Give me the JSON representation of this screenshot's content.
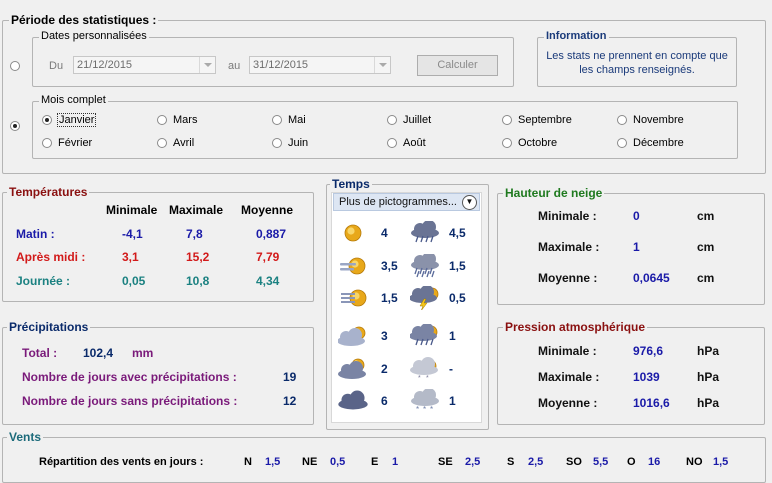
{
  "periode": {
    "title": "Période des statistiques :",
    "dates_perso": {
      "title": "Dates personnalisées",
      "du_label": "Du",
      "du_value": "21/12/2015",
      "au_label": "au",
      "au_value": "31/12/2015",
      "calc_label": "Calculer"
    },
    "info": {
      "title": "Information",
      "line1": "Les stats ne prennent en compte que",
      "line2": "les champs renseignés."
    },
    "mois": {
      "title": "Mois complet",
      "months": [
        "Janvier",
        "Février",
        "Mars",
        "Avril",
        "Mai",
        "Juin",
        "Juillet",
        "Août",
        "Septembre",
        "Octobre",
        "Novembre",
        "Décembre"
      ],
      "selected": "Janvier"
    }
  },
  "temperatures": {
    "title": "Températures",
    "headers": [
      "Minimale",
      "Maximale",
      "Moyenne"
    ],
    "rows": [
      {
        "label": "Matin :",
        "min": "-4,1",
        "max": "7,8",
        "moy": "0,887"
      },
      {
        "label": "Après midi :",
        "min": "3,1",
        "max": "15,2",
        "moy": "7,79"
      },
      {
        "label": "Journée :",
        "min": "0,05",
        "max": "10,8",
        "moy": "4,34"
      }
    ]
  },
  "precipitations": {
    "title": "Précipitations",
    "total_label": "Total :",
    "total_value": "102,4",
    "total_unit": "mm",
    "avec_label": "Nombre de jours avec précipitations :",
    "avec_value": "19",
    "sans_label": "Nombre de jours sans précipitations :",
    "sans_value": "12"
  },
  "temps": {
    "title": "Temps",
    "dropdown": "Plus de pictogrammes...",
    "left": [
      {
        "icon": "sun-icon",
        "value": "4"
      },
      {
        "icon": "fog-sun-icon",
        "value": "3,5"
      },
      {
        "icon": "haze-sun-icon",
        "value": "1,5"
      },
      {
        "icon": "partly-cloudy-icon",
        "value": "3"
      },
      {
        "icon": "mostly-cloudy-icon",
        "value": "2"
      },
      {
        "icon": "overcast-icon",
        "value": "6"
      }
    ],
    "right": [
      {
        "icon": "rain-shower-icon",
        "value": "4,5"
      },
      {
        "icon": "heavy-rain-icon",
        "value": "1,5"
      },
      {
        "icon": "thunderstorm-icon",
        "value": "0,5"
      },
      {
        "icon": "sun-rain-icon",
        "value": "1"
      },
      {
        "icon": "sleet-icon",
        "value": "-"
      },
      {
        "icon": "snow-icon",
        "value": "1"
      }
    ]
  },
  "neige": {
    "title": "Hauteur de neige",
    "rows": [
      {
        "label": "Minimale :",
        "value": "0",
        "unit": "cm"
      },
      {
        "label": "Maximale :",
        "value": "1",
        "unit": "cm"
      },
      {
        "label": "Moyenne :",
        "value": "0,0645",
        "unit": "cm"
      }
    ]
  },
  "pression": {
    "title": "Pression atmosphérique",
    "rows": [
      {
        "label": "Minimale :",
        "value": "976,6",
        "unit": "hPa"
      },
      {
        "label": "Maximale :",
        "value": "1039",
        "unit": "hPa"
      },
      {
        "label": "Moyenne :",
        "value": "1016,6",
        "unit": "hPa"
      }
    ]
  },
  "vents": {
    "title": "Vents",
    "label": "Répartition des vents en jours :",
    "dirs": [
      {
        "dir": "N",
        "value": "1,5"
      },
      {
        "dir": "NE",
        "value": "0,5"
      },
      {
        "dir": "E",
        "value": "1"
      },
      {
        "dir": "SE",
        "value": "2,5"
      },
      {
        "dir": "S",
        "value": "2,5"
      },
      {
        "dir": "SO",
        "value": "5,5"
      },
      {
        "dir": "O",
        "value": "16"
      },
      {
        "dir": "NO",
        "value": "1,5"
      }
    ]
  }
}
